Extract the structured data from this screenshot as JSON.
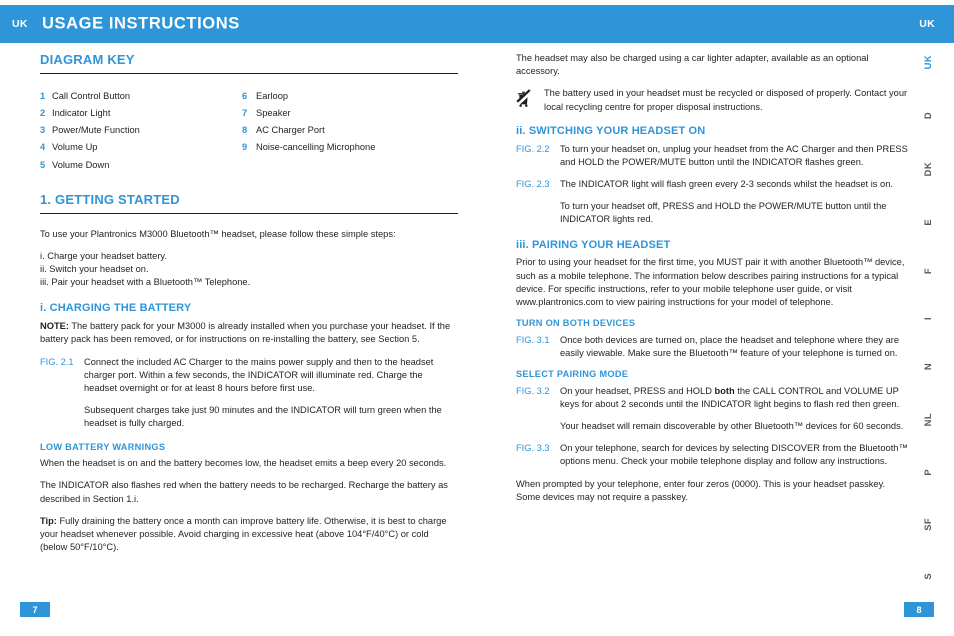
{
  "header": {
    "lang_left": "UK",
    "title": "USAGE INSTRUCTIONS",
    "lang_right": "UK",
    "bar_color": "#2e95d8"
  },
  "left_page": {
    "page_number": "7",
    "diagram_key": {
      "heading": "DIAGRAM KEY",
      "items_left": [
        {
          "num": "1",
          "label": "Call Control Button"
        },
        {
          "num": "2",
          "label": "Indicator Light"
        },
        {
          "num": "3",
          "label": "Power/Mute Function"
        },
        {
          "num": "4",
          "label": "Volume Up"
        },
        {
          "num": "5",
          "label": "Volume Down"
        }
      ],
      "items_right": [
        {
          "num": "6",
          "label": "Earloop"
        },
        {
          "num": "7",
          "label": "Speaker"
        },
        {
          "num": "8",
          "label": "AC Charger Port"
        },
        {
          "num": "9",
          "label": "Noise-cancelling Microphone"
        }
      ]
    },
    "getting_started": {
      "heading": "1. GETTING STARTED",
      "intro": "To use your Plantronics M3000 Bluetooth™ headset, please follow these simple steps:",
      "steps": "i. Charge your headset battery.\nii. Switch your headset on.\niii. Pair your headset with a Bluetooth™ Telephone.",
      "step_1": "i. Charge your headset battery.",
      "step_2": "ii. Switch your headset on.",
      "step_3": "iii. Pair your headset with a Bluetooth™ Telephone."
    },
    "charging": {
      "heading": "i. CHARGING THE BATTERY",
      "note_label": "NOTE:",
      "note_text": " The battery pack for your M3000 is already installed when you purchase your headset. If the battery pack has been removed, or for instructions on re-installing the battery, see Section 5.",
      "fig_2_1_tag": "FIG. 2.1",
      "fig_2_1_text": "Connect the included AC Charger to the mains power supply and then to the headset charger port. Within a few seconds, the INDICATOR will illuminate red. Charge the headset overnight or for at least 8 hours before first use.",
      "fig_2_1_cont": "Subsequent charges take just 90 minutes and the INDICATOR will turn green when the headset is fully charged."
    },
    "low_battery": {
      "heading": "LOW BATTERY WARNINGS",
      "para_1": "When the headset is on and the battery becomes low, the headset emits a beep every 20 seconds.",
      "para_2": "The INDICATOR also flashes red when the battery needs to be recharged. Recharge the battery as described in Section 1.i.",
      "tip_label": "Tip:",
      "tip_text": " Fully draining the battery once a month can improve battery life. Otherwise, it is best to charge your headset whenever possible. Avoid charging in excessive heat (above 104°F/40°C) or cold (below 50°F/10°C)."
    }
  },
  "right_page": {
    "page_number": "8",
    "car_adapter_note": "The headset may also be charged using a car lighter adapter, available as an optional accessory.",
    "weee": {
      "icon": "crossed-out-wheelie-bin-icon",
      "text": "The battery used in your headset must be recycled or disposed of properly. Contact your local recycling centre for proper disposal instructions."
    },
    "switching_on": {
      "heading": "ii. SWITCHING YOUR HEADSET ON",
      "fig_2_2_tag": "FIG. 2.2",
      "fig_2_2_text": "To turn your headset on, unplug your headset from the AC Charger and then PRESS and HOLD the POWER/MUTE button until the INDICATOR flashes green.",
      "fig_2_3_tag": "FIG. 2.3",
      "fig_2_3_text": "The INDICATOR light will flash green every 2-3 seconds whilst the headset is on.",
      "fig_2_3_cont": "To turn your headset off, PRESS and HOLD the POWER/MUTE button until the INDICATOR lights red."
    },
    "pairing": {
      "heading": "iii. PAIRING YOUR HEADSET",
      "intro": "Prior to using your headset for the first time, you MUST pair it with another Bluetooth™ device, such as a mobile telephone. The information below describes pairing instructions for a typical device. For specific instructions, refer to your mobile telephone user guide, or visit www.plantronics.com to view pairing instructions for your model of telephone.",
      "turn_on_heading": "TURN ON BOTH DEVICES",
      "fig_3_1_tag": "FIG. 3.1",
      "fig_3_1_text": "Once both devices are turned on, place the headset and telephone where they are easily viewable. Make sure the Bluetooth™ feature of your telephone is turned on.",
      "select_mode_heading": "SELECT PAIRING MODE",
      "fig_3_2_tag": "FIG. 3.2",
      "fig_3_2_text_a": "On your headset, PRESS and HOLD ",
      "fig_3_2_bold": "both",
      "fig_3_2_text_b": " the CALL CONTROL and VOLUME UP keys for about 2 seconds until the INDICATOR light begins to flash red then green.",
      "fig_3_2_cont": "Your headset will remain discoverable by other Bluetooth™ devices for 60 seconds.",
      "fig_3_3_tag": "FIG. 3.3",
      "fig_3_3_text": "On your telephone, search for devices by selecting DISCOVER from the Bluetooth™ options menu. Check your mobile telephone display and follow any instructions.",
      "passkey_note": "When prompted by your telephone, enter four zeros (0000). This is your headset passkey. Some devices may not require a passkey."
    }
  },
  "language_rail": {
    "active": "UK",
    "tabs": [
      "UK",
      "D",
      "DK",
      "E",
      "F",
      "I",
      "N",
      "NL",
      "P",
      "SF",
      "S"
    ]
  }
}
